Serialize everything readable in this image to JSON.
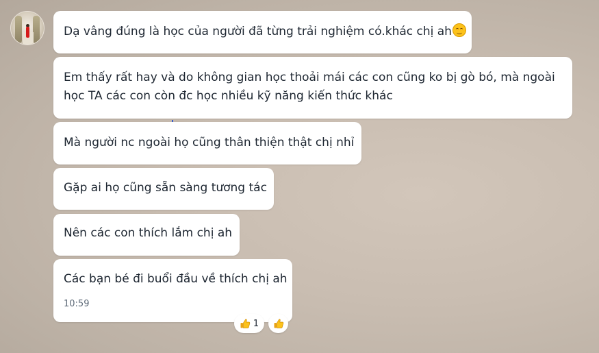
{
  "sender": {
    "avatar_icon": "user-avatar"
  },
  "messages": [
    {
      "text": "Dạ vâng đúng là học của người đã từng trải nghiệm có.khác chị ah",
      "emoji": "smiling-face-icon"
    },
    {
      "text": "Em thấy rất hay và do không gian học thoải mái các con cũng ko bị gò bó, mà ngoài học TA các con còn đc học nhiều kỹ năng kiến thức khác"
    },
    {
      "text": "Mà người nc ngoài họ cũng thân thiện thật chị nhỉ"
    },
    {
      "text": "Gặp ai họ cũng sẵn sàng tương tác"
    },
    {
      "text": "Nên các con thích lắm chị ah"
    },
    {
      "text": "Các bạn bé đi buổi đầu về thích chị ah",
      "time": "10:59"
    }
  ],
  "reactions": {
    "thumbs_up_count": "1",
    "icon": "thumbs-up-icon",
    "quick_react_icon": "thumbs-up-icon"
  },
  "colors": {
    "bubble": "#ffffff",
    "text": "#1c2530",
    "time": "#5e6a78",
    "emoji": "#fcc21b"
  }
}
